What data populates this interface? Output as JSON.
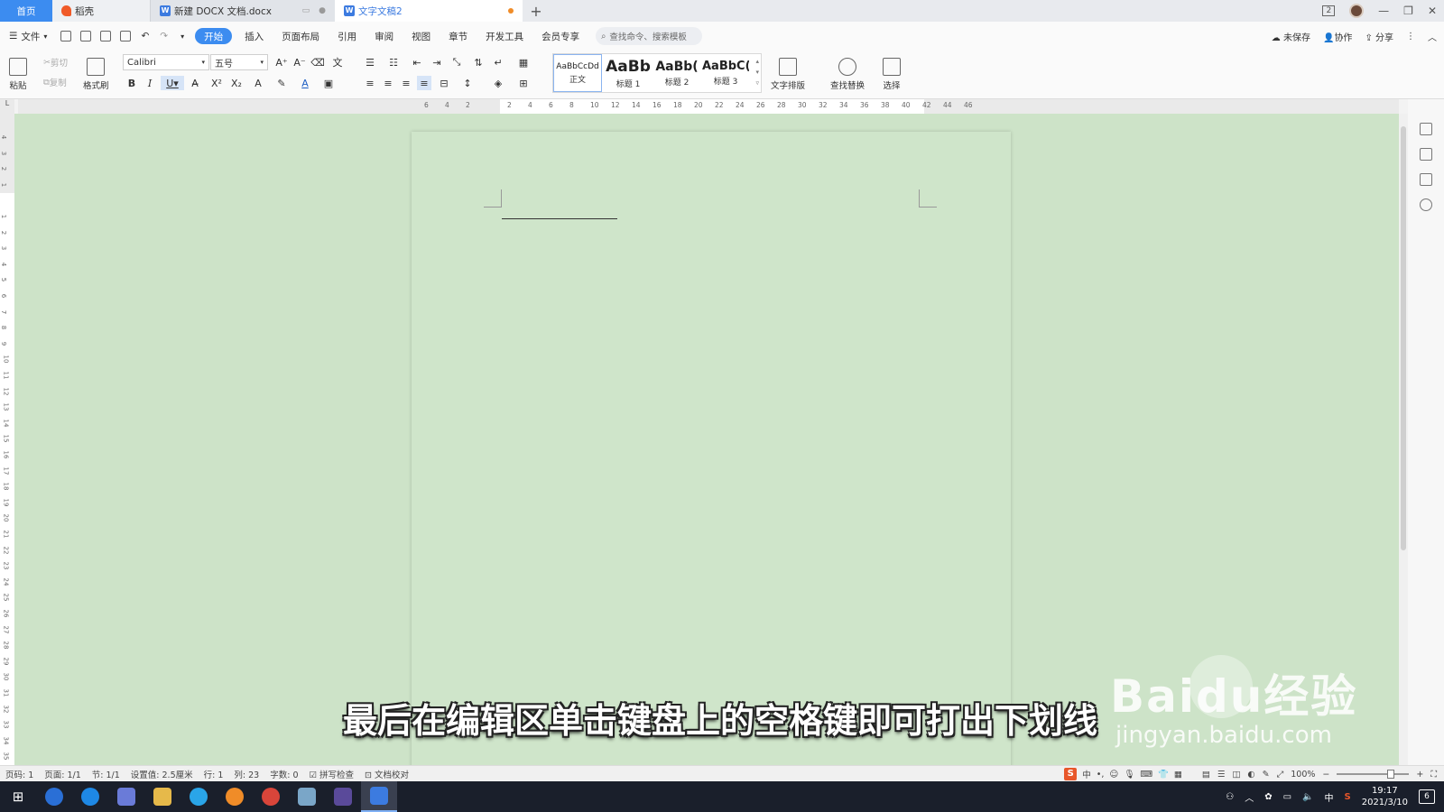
{
  "tabs": {
    "home": "首页",
    "daoke": "稻壳",
    "doc1": "新建 DOCX 文档.docx",
    "doc2": "文字文稿2",
    "add": "+"
  },
  "window_controls": {
    "badge": "2",
    "minimize": "—",
    "restore": "❐",
    "close": "✕"
  },
  "menu": {
    "file": "文件",
    "items": [
      "开始",
      "插入",
      "页面布局",
      "引用",
      "审阅",
      "视图",
      "章节",
      "开发工具",
      "会员专享"
    ],
    "active_index": 0,
    "search_placeholder": "查找命令、搜索模板",
    "unsaved": "未保存",
    "collab": "协作",
    "share": "分享"
  },
  "ribbon": {
    "paste": "粘贴",
    "cut": "剪切",
    "copy": "复制",
    "format_painter": "格式刷",
    "font_name": "Calibri",
    "font_size": "五号",
    "styles": [
      {
        "preview": "AaBbCcDd",
        "label": "正文"
      },
      {
        "preview": "AaBb",
        "label": "标题 1"
      },
      {
        "preview": "AaBb(",
        "label": "标题 2"
      },
      {
        "preview": "AaBbC(",
        "label": "标题 3"
      }
    ],
    "text_layout": "文字排版",
    "find_replace": "查找替换",
    "select": "选择"
  },
  "ruler_ticks": [
    "6",
    "4",
    "2",
    "",
    "2",
    "4",
    "6",
    "8",
    "10",
    "12",
    "14",
    "16",
    "18",
    "20",
    "22",
    "24",
    "26",
    "28",
    "30",
    "32",
    "34",
    "36",
    "38",
    "40",
    "42",
    "44",
    "46"
  ],
  "vruler_ticks": [
    "4",
    "3",
    "2",
    "1",
    "",
    "1",
    "2",
    "3",
    "4",
    "5",
    "6",
    "7",
    "8",
    "9",
    "10",
    "11",
    "12",
    "13",
    "14",
    "15",
    "16",
    "17",
    "18",
    "19",
    "20",
    "21",
    "22",
    "23",
    "24",
    "25",
    "26",
    "27",
    "28",
    "29",
    "30",
    "31",
    "32",
    "33",
    "34",
    "35"
  ],
  "caption": "最后在编辑区单击键盘上的空格键即可打出下划线",
  "watermark": {
    "brand": "Baidu经验",
    "url": "jingyan.baidu.com"
  },
  "status": {
    "page_num": "页码: 1",
    "pages": "页面: 1/1",
    "section": "节: 1/1",
    "position": "设置值: 2.5厘米",
    "row": "行: 1",
    "col": "列: 23",
    "words": "字数: 0",
    "spell": "拼写检查",
    "proof": "文档校对",
    "ime_mode": "中",
    "zoom": "100%"
  },
  "taskbar": {
    "time": "19:17",
    "date": "2021/3/10",
    "ime": "中",
    "notifications": "6"
  },
  "colors": {
    "accent": "#3c8cf0",
    "canvas": "#cde3c8",
    "taskbar": "#1a1f2b"
  }
}
